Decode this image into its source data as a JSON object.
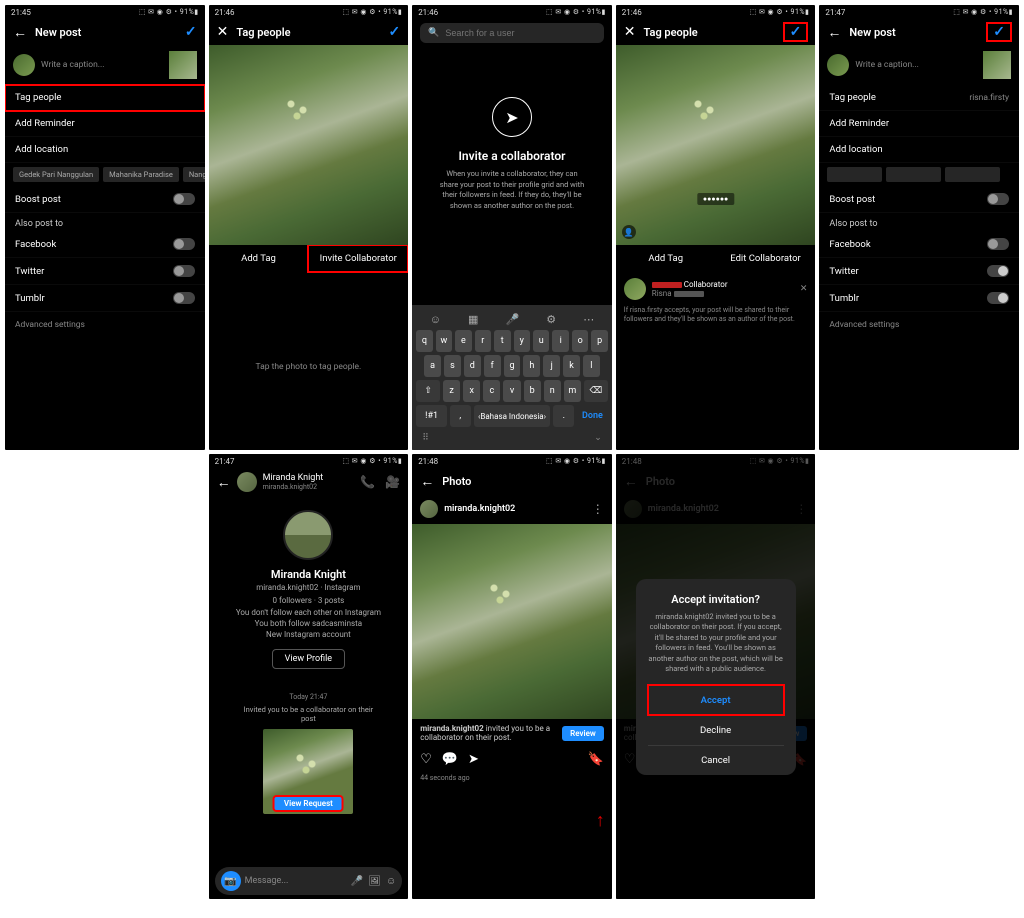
{
  "status": {
    "times": [
      "21:45",
      "21:46",
      "21:46",
      "21:46",
      "21:47",
      "21:47",
      "21:48",
      "21:48"
    ],
    "bat": "91%",
    "icons": "⬚ ✉ ◉ ⚙ •"
  },
  "s1": {
    "title": "New post",
    "caption_ph": "Write a caption...",
    "tag": "Tag people",
    "reminder": "Add Reminder",
    "location": "Add location",
    "chips": [
      "Gedek Pari Nanggulan",
      "Mahanika Paradise",
      "Nanggulan, Jawa Teng"
    ],
    "boost": "Boost post",
    "also": "Also post to",
    "fb": "Facebook",
    "tw": "Twitter",
    "tb": "Tumblr",
    "adv": "Advanced settings"
  },
  "s2": {
    "title": "Tag people",
    "add": "Add Tag",
    "invite": "Invite Collaborator",
    "hint": "Tap the photo to tag people."
  },
  "s3": {
    "search_ph": "Search for a user",
    "title": "Invite a collaborator",
    "sub": "When you invite a collaborator, they can share your post to their profile grid and with their followers in feed. If they do, they'll be shown as another author on the post.",
    "rows": [
      "q",
      "w",
      "e",
      "r",
      "t",
      "y",
      "u",
      "i",
      "o",
      "p"
    ],
    "rows2": [
      "a",
      "s",
      "d",
      "f",
      "g",
      "h",
      "j",
      "k",
      "l"
    ],
    "rows3": [
      "z",
      "x",
      "c",
      "v",
      "b",
      "n",
      "m"
    ],
    "lang": "Bahasa Indonesia",
    "done": "Done"
  },
  "s4": {
    "title": "Tag people",
    "add": "Add Tag",
    "edit": "Edit Collaborator",
    "collab_label": "Collaborator",
    "collab_user": "Risna",
    "note": "If risna.firsty accepts, your post will be shared to their followers and they'll be shown as an author of the post."
  },
  "s5": {
    "title": "New post",
    "caption_ph": "Write a caption...",
    "tag": "Tag people",
    "tag_val": "risna.firsty",
    "reminder": "Add Reminder",
    "location": "Add location",
    "boost": "Boost post",
    "also": "Also post to",
    "fb": "Facebook",
    "tw": "Twitter",
    "tb": "Tumblr",
    "adv": "Advanced settings"
  },
  "s6": {
    "name": "Miranda Knight",
    "user": "miranda.knight02",
    "user2": "miranda.knight02 · Instagram",
    "stats": "0 followers · 3 posts",
    "l1": "You don't follow each other on Instagram",
    "l2": "You both follow sadcasminsta",
    "l3": "New Instagram account",
    "vp": "View Profile",
    "today": "Today 21:47",
    "inv": "Invited you to be a collaborator on their post",
    "vr": "View Request",
    "msg_ph": "Message..."
  },
  "s7": {
    "title": "Photo",
    "user": "miranda.knight02",
    "inv_text": " invited you to be a collaborator on their post.",
    "review": "Review",
    "ago": "44 seconds ago"
  },
  "s8": {
    "title": "Photo",
    "m_title": "Accept invitation?",
    "m_body": "miranda.knight02 invited you to be a collaborator on their post. If you accept, it'll be shared to your profile and your followers in feed. You'll be shown as another author on the post, which will be shared with a public audience.",
    "accept": "Accept",
    "decline": "Decline",
    "cancel": "Cancel"
  }
}
